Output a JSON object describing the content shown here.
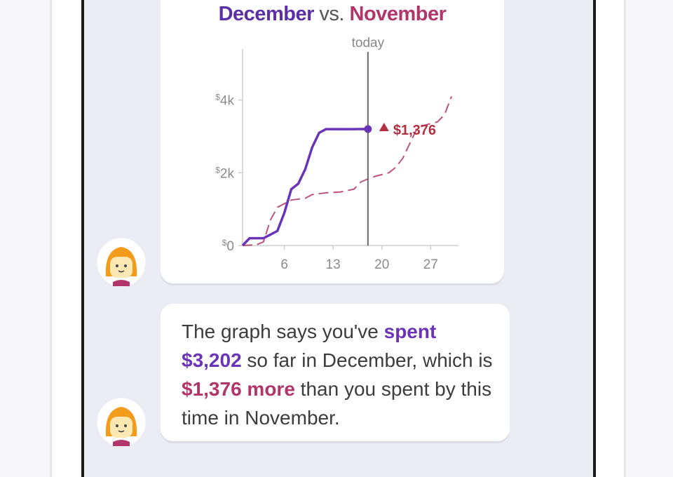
{
  "chart_card": {
    "title_part1": "December",
    "title_vs": "vs.",
    "title_part2": "November",
    "marker_label": "today",
    "delta_label": "$1,376"
  },
  "message": {
    "t1": "The graph says you've ",
    "t2": "spent",
    "t3": "$3,202",
    "t4": " so far in December, which is ",
    "t5": "$1,376 more",
    "t6": " than you spent by this time in November."
  },
  "avatar": {
    "icon": "girl-avatar-icon"
  },
  "colors": {
    "december": "#6a34b8",
    "november": "#b1356a",
    "up_arrow": "#b23041"
  },
  "chart_data": {
    "type": "line",
    "title": "December vs. November",
    "xlabel": "",
    "ylabel": "",
    "xlim": [
      0,
      31
    ],
    "ylim": [
      0,
      5400
    ],
    "x_ticks": [
      6,
      13,
      20,
      27
    ],
    "y_ticks": [
      0,
      2000,
      4000
    ],
    "y_tick_labels": [
      "$0",
      "$2k",
      "$4k"
    ],
    "marker": {
      "x": 18,
      "label": "today"
    },
    "annotation": {
      "x": 18,
      "y": 3202,
      "label": "$1,376",
      "direction": "up"
    },
    "series": [
      {
        "name": "December",
        "style": "solid",
        "x": [
          0,
          1,
          2,
          3,
          4,
          5,
          6,
          7,
          8,
          9,
          10,
          11,
          12,
          13,
          14,
          15,
          16,
          17,
          18
        ],
        "y": [
          0,
          200,
          200,
          200,
          300,
          400,
          900,
          1550,
          1700,
          2100,
          2700,
          3100,
          3200,
          3200,
          3200,
          3200,
          3200,
          3202,
          3202
        ]
      },
      {
        "name": "November",
        "style": "dashed",
        "x": [
          0,
          2,
          3,
          4,
          5,
          7,
          9,
          10,
          12,
          14,
          16,
          17,
          18,
          19,
          21,
          22,
          23,
          24,
          25,
          26,
          27,
          28,
          29,
          30
        ],
        "y": [
          0,
          20,
          100,
          700,
          1050,
          1250,
          1300,
          1400,
          1450,
          1470,
          1550,
          1750,
          1830,
          1900,
          2000,
          2150,
          2400,
          2800,
          3200,
          3300,
          3350,
          3400,
          3600,
          4100
        ]
      }
    ]
  }
}
